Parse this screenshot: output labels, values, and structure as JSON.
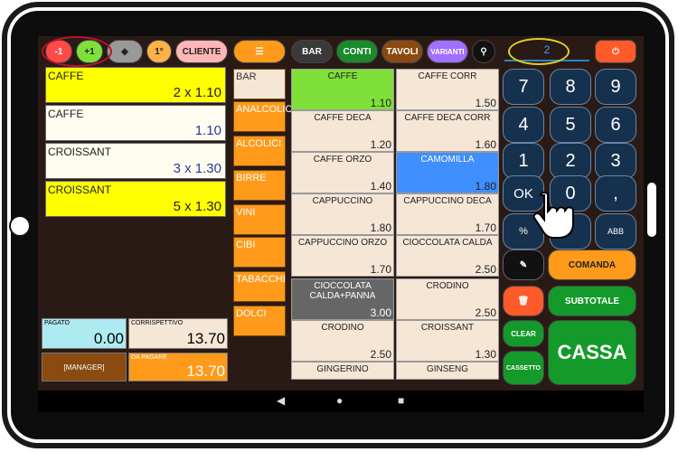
{
  "topbar": {
    "minus": "-1",
    "plus": "+1",
    "course": "1°",
    "cliente": "CLIENTE",
    "bar": "BAR",
    "conti": "CONTI",
    "tavoli": "TAVOLI",
    "varianti": "VARIANTI",
    "display_value": "2"
  },
  "orders": [
    {
      "name": "CAFFE",
      "qty": "2 x 1.10"
    },
    {
      "name": "CAFFE",
      "qty": "1.10"
    },
    {
      "name": "CROISSANT",
      "qty": "3 x 1.30"
    },
    {
      "name": "CROISSANT",
      "qty": "5 x 1.30"
    }
  ],
  "totals": {
    "pagato_label": "PAGATO",
    "pagato_value": "0.00",
    "corrispettivo_label": "CORRISPETTIVO",
    "corrispettivo_value": "13.70",
    "manager": "[MANAGER]",
    "da_pagare_label": "DA PAGARE",
    "da_pagare_value": "13.70"
  },
  "categories": [
    "BAR",
    "ANALCOLICI",
    "ALCOLICI",
    "BIRRE",
    "VINI",
    "CIBI",
    "TABACCHI",
    "DOLCI"
  ],
  "products": [
    {
      "name": "CAFFE",
      "price": "1.10"
    },
    {
      "name": "CAFFE CORR",
      "price": "1.50"
    },
    {
      "name": "CAFFE DECA",
      "price": "1.20"
    },
    {
      "name": "CAFFE DECA CORR",
      "price": "1.60"
    },
    {
      "name": "CAFFE ORZO",
      "price": "1.40"
    },
    {
      "name": "CAMOMILLA",
      "price": "1.80"
    },
    {
      "name": "CAPPUCCINO",
      "price": "1.80"
    },
    {
      "name": "CAPPUCCINO DECA",
      "price": "1.70"
    },
    {
      "name": "CAPPUCCINO ORZO",
      "price": "1.70"
    },
    {
      "name": "CIOCCOLATA CALDA",
      "price": "2.50"
    },
    {
      "name": "CIOCCOLATA CALDA+PANNA",
      "price": "3.00"
    },
    {
      "name": "CRODINO",
      "price": "2.50"
    },
    {
      "name": "CRODINO",
      "price": "2.50"
    },
    {
      "name": "CROISSANT",
      "price": "1.30"
    },
    {
      "name": "GINGERINO",
      "price": ""
    },
    {
      "name": "GINSENG",
      "price": ""
    }
  ],
  "keypad": {
    "k7": "7",
    "k8": "8",
    "k9": "9",
    "k4": "4",
    "k5": "5",
    "k6": "6",
    "k1": "1",
    "k2": "2",
    "k3": "3",
    "ok": "OK",
    "zero": "0",
    "comma": ",",
    "percent": "%",
    "abb": "ABB"
  },
  "actions": {
    "comanda": "COMANDA",
    "subtotale": "SUBTOTALE",
    "clear": "CLEAR",
    "cassetto": "CASSETTO",
    "cassa": "CASSA"
  },
  "colors": {
    "order_highlight": "#ffff00",
    "selected_green": "#7fe03a",
    "selected_blue": "#3f8fff",
    "dark_product": "#666666",
    "keypad_blue": "#16314d",
    "action_green": "#149a2a",
    "orange": "#ff9a1a"
  }
}
